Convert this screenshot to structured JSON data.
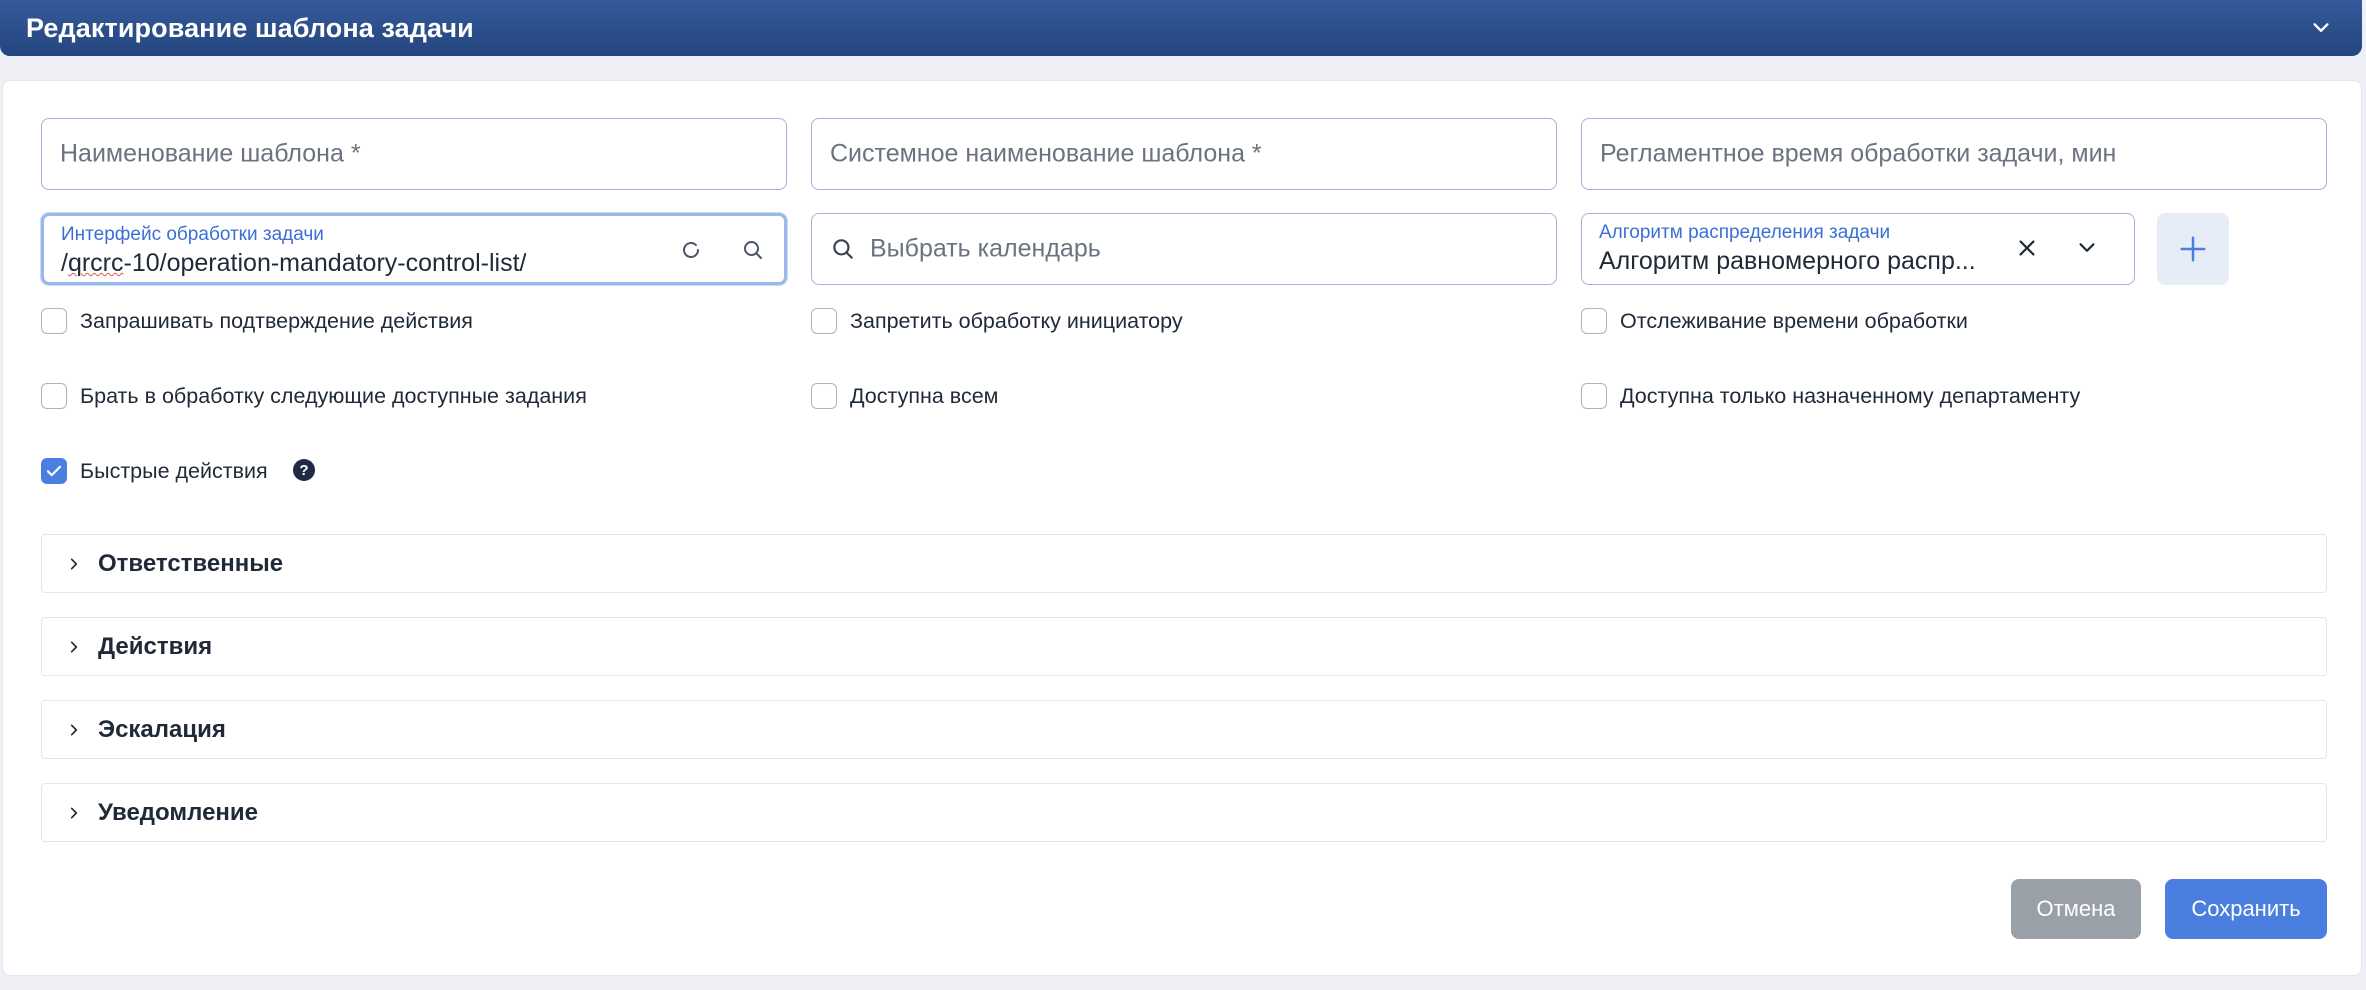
{
  "header": {
    "title": "Редактирование шаблона задачи"
  },
  "fields": {
    "template_name": {
      "placeholder": "Наименование шаблона *"
    },
    "system_name": {
      "placeholder": "Системное наименование шаблона *"
    },
    "reg_time": {
      "placeholder": "Регламентное время обработки задачи, мин"
    },
    "interface": {
      "label": "Интерфейс обработки задачи",
      "value_prefix": "/",
      "value_squiggle": "qrcrc",
      "value_rest": "-10/operation-mandatory-control-list/"
    },
    "calendar": {
      "placeholder": "Выбрать календарь"
    },
    "algorithm": {
      "label": "Алгоритм распределения задачи",
      "value": "Алгоритм равномерного распр..."
    }
  },
  "checkboxes": {
    "confirm_action": {
      "label": "Запрашивать подтверждение действия",
      "checked": false
    },
    "forbid_initiator": {
      "label": "Запретить обработку инициатору",
      "checked": false
    },
    "time_tracking": {
      "label": "Отслеживание времени обработки",
      "checked": false
    },
    "take_next": {
      "label": "Брать в обработку следующие доступные задания",
      "checked": false
    },
    "available_all": {
      "label": "Доступна всем",
      "checked": false
    },
    "dept_only": {
      "label": "Доступна только назначенному департаменту",
      "checked": false
    },
    "quick_actions": {
      "label": "Быстрые действия",
      "checked": true
    }
  },
  "help_glyph": "?",
  "sections": [
    {
      "title": "Ответственные"
    },
    {
      "title": "Действия"
    },
    {
      "title": "Эскалация"
    },
    {
      "title": "Уведомление"
    }
  ],
  "buttons": {
    "cancel": "Отмена",
    "save": "Сохранить"
  },
  "icons": {
    "header_toggle": "chevron-down-icon",
    "refresh": "refresh-icon",
    "search": "search-icon",
    "clear": "close-icon",
    "dropdown": "chevron-down-icon",
    "add": "plus-icon",
    "section_arrow": "chevron-right-icon"
  },
  "colors": {
    "header": "#2b4e8a",
    "accent": "#4a7fe0",
    "cancel": "#9aa0a8",
    "label": "#3b6fd6"
  }
}
